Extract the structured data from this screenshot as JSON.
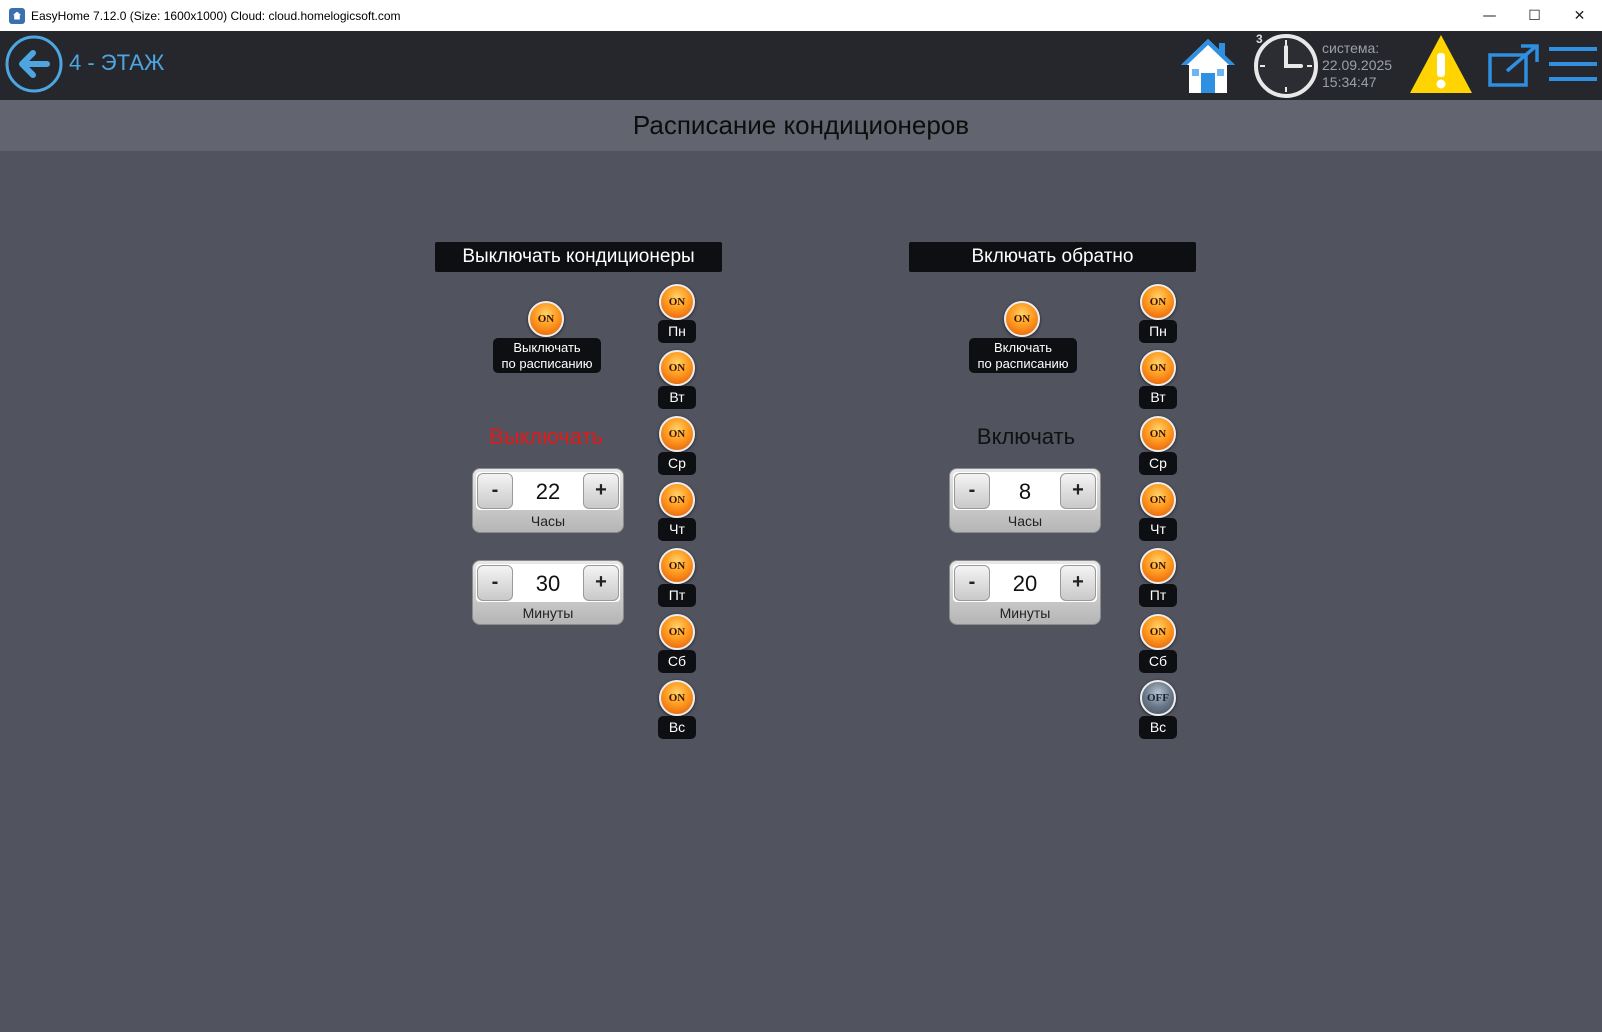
{
  "window": {
    "title": "EasyHome 7.12.0 (Size: 1600x1000) Cloud: cloud.homelogicsoft.com",
    "minimize": "—",
    "maximize": "☐",
    "close": "✕"
  },
  "header": {
    "floor_title": "4 - ЭТАЖ",
    "clock_badge": "3",
    "system_label": "система:",
    "date": "22.09.2025",
    "time": "15:34:47",
    "accent_color": "#4ea6e0"
  },
  "page_title": "Расписание кондиционеров",
  "panels": [
    {
      "header": "Выключать кондиционеры",
      "schedule_toggle": {
        "state": "ON",
        "label_line1": "Выключать",
        "label_line2": "по расписанию"
      },
      "mode_label": "Выключать",
      "mode_color": "#e01b1b",
      "hours": {
        "minus": "-",
        "value": "22",
        "plus": "+",
        "caption": "Часы"
      },
      "minutes": {
        "minus": "-",
        "value": "30",
        "plus": "+",
        "caption": "Минуты"
      },
      "days": [
        {
          "label": "Пн",
          "state": "ON"
        },
        {
          "label": "Вт",
          "state": "ON"
        },
        {
          "label": "Ср",
          "state": "ON"
        },
        {
          "label": "Чт",
          "state": "ON"
        },
        {
          "label": "Пт",
          "state": "ON"
        },
        {
          "label": "Сб",
          "state": "ON"
        },
        {
          "label": "Вс",
          "state": "ON"
        }
      ]
    },
    {
      "header": "Включать обратно",
      "schedule_toggle": {
        "state": "ON",
        "label_line1": "Включать",
        "label_line2": "по расписанию"
      },
      "mode_label": "Включать",
      "mode_color": "#111111",
      "hours": {
        "minus": "-",
        "value": "8",
        "plus": "+",
        "caption": "Часы"
      },
      "minutes": {
        "minus": "-",
        "value": "20",
        "plus": "+",
        "caption": "Минуты"
      },
      "days": [
        {
          "label": "Пн",
          "state": "ON"
        },
        {
          "label": "Вт",
          "state": "ON"
        },
        {
          "label": "Ср",
          "state": "ON"
        },
        {
          "label": "Чт",
          "state": "ON"
        },
        {
          "label": "Пт",
          "state": "ON"
        },
        {
          "label": "Сб",
          "state": "ON"
        },
        {
          "label": "Вс",
          "state": "OFF"
        }
      ]
    }
  ]
}
